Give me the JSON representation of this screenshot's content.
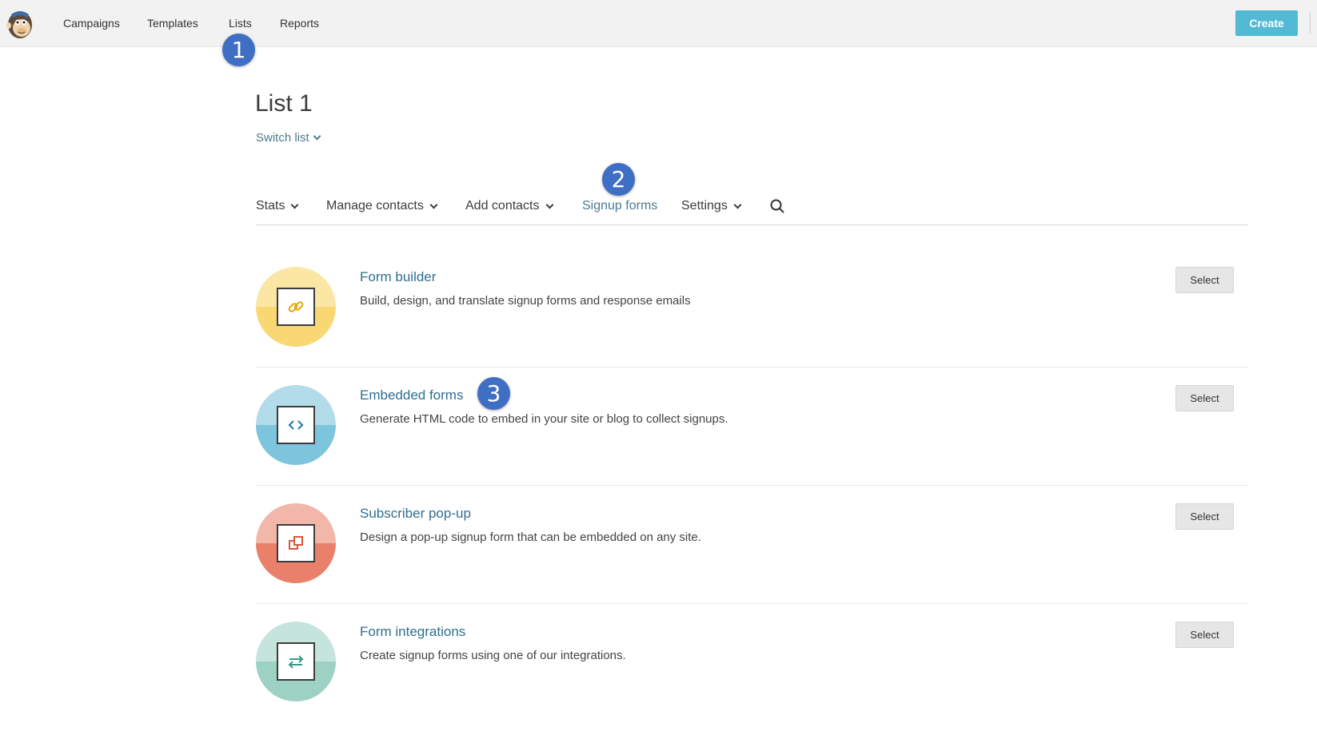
{
  "topnav": {
    "items": [
      "Campaigns",
      "Templates",
      "Lists",
      "Reports"
    ],
    "create_label": "Create"
  },
  "callouts": [
    "1",
    "2",
    "3"
  ],
  "page": {
    "title": "List 1",
    "switch_list": "Switch list"
  },
  "subnav": {
    "items": [
      "Stats",
      "Manage contacts",
      "Add contacts",
      "Signup forms",
      "Settings"
    ],
    "active": "Signup forms"
  },
  "options": [
    {
      "title": "Form builder",
      "description": "Build, design, and translate signup forms and response emails",
      "button": "Select",
      "icon": "link-icon",
      "color_light": "#fbe6a4",
      "color_dark": "#f9d874"
    },
    {
      "title": "Embedded forms",
      "description": "Generate HTML code to embed in your site or blog to collect signups.",
      "button": "Select",
      "icon": "code-icon",
      "color_light": "#b3dceb",
      "color_dark": "#7dc4dd"
    },
    {
      "title": "Subscriber pop-up",
      "description": "Design a pop-up signup form that can be embedded on any site.",
      "button": "Select",
      "icon": "popup-icon",
      "color_light": "#f2b7a8",
      "color_dark": "#e8806a"
    },
    {
      "title": "Form integrations",
      "description": "Create signup forms using one of our integrations.",
      "button": "Select",
      "icon": "swap-arrows-icon",
      "color_light": "#c5e4dc",
      "color_dark": "#9dd1c3"
    }
  ],
  "colors": {
    "accent": "#52bad5",
    "link": "#4d7a96",
    "callout": "#3f6fc4"
  }
}
